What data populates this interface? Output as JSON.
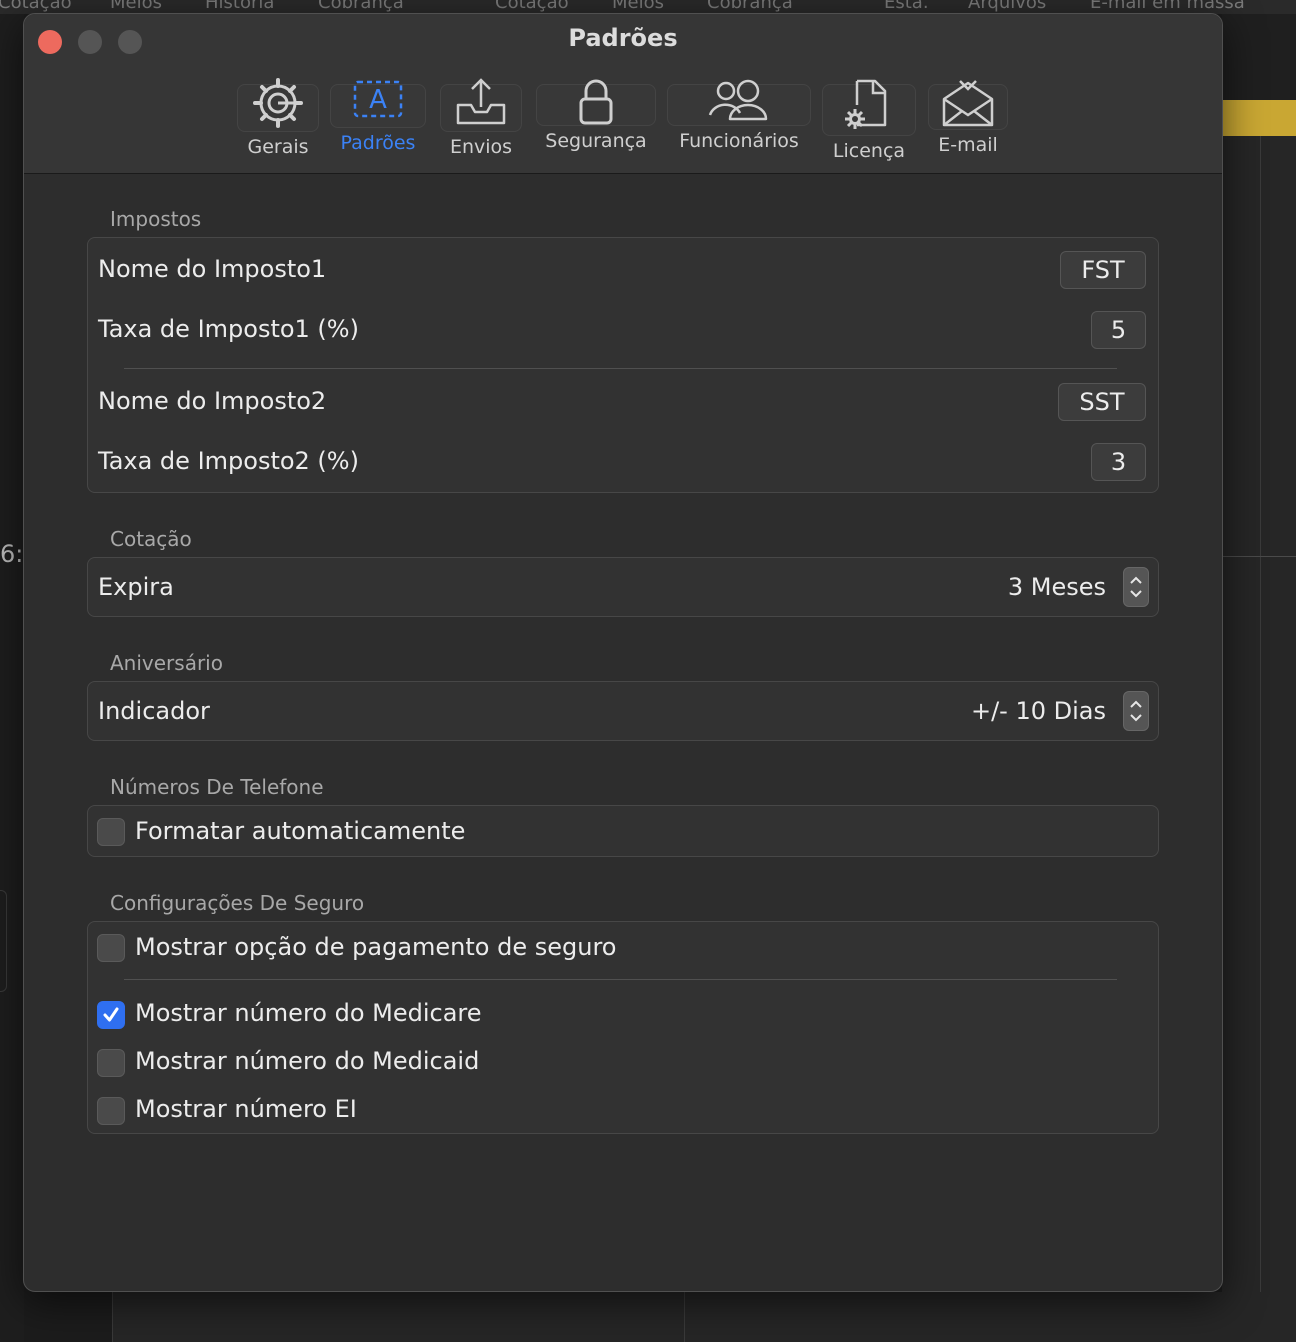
{
  "background": {
    "top_tabs": [
      "Cotação",
      "Meios",
      "História",
      "Cobrança",
      "Cotação",
      "Meios",
      "Cobrança",
      "Esta.",
      "Arquivos",
      "E-mail em massa"
    ],
    "left_fragment": "6:"
  },
  "window": {
    "title": "Padrões",
    "traffic_lights": {
      "close_color": "#ed6a5e",
      "inactive_color": "#555555"
    }
  },
  "toolbar": {
    "accent_color": "#3b82f6",
    "tabs": [
      {
        "label": "Gerais",
        "icon": "gear-icon",
        "active": false
      },
      {
        "label": "Padrões",
        "icon": "text-a-icon",
        "active": true
      },
      {
        "label": "Envios",
        "icon": "tray-upload-icon",
        "active": false
      },
      {
        "label": "Segurança",
        "icon": "lock-icon",
        "active": false
      },
      {
        "label": "Funcionários",
        "icon": "people-icon",
        "active": false
      },
      {
        "label": "Licença",
        "icon": "document-gear-icon",
        "active": false
      },
      {
        "label": "E-mail",
        "icon": "envelope-icon",
        "active": false
      }
    ]
  },
  "taxes": {
    "section_title": "Impostos",
    "tax1_name_label": "Nome do Imposto1",
    "tax1_name_value": "FST",
    "tax1_rate_label": "Taxa de Imposto1 (%)",
    "tax1_rate_value": "5",
    "tax2_name_label": "Nome do Imposto2",
    "tax2_name_value": "SST",
    "tax2_rate_label": "Taxa de Imposto2 (%)",
    "tax2_rate_value": "3"
  },
  "quote": {
    "section_title": "Cotação",
    "expires_label": "Expira",
    "expires_value": "3 Meses"
  },
  "birthday": {
    "section_title": "Aniversário",
    "indicator_label": "Indicador",
    "indicator_value": "+/- 10 Dias"
  },
  "phone": {
    "section_title": "Números De Telefone",
    "auto_format_label": "Formatar automaticamente",
    "auto_format_checked": false
  },
  "insurance": {
    "section_title": "Configurações De Seguro",
    "options": [
      {
        "label": "Mostrar opção de pagamento de seguro",
        "checked": false
      },
      {
        "label": "Mostrar número do Medicare",
        "checked": true
      },
      {
        "label": "Mostrar número do Medicaid",
        "checked": false
      },
      {
        "label": "Mostrar número EI",
        "checked": false
      }
    ]
  }
}
